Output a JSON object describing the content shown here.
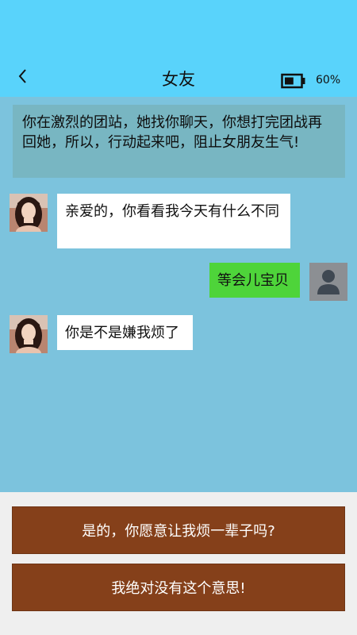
{
  "header": {
    "title": "女友",
    "battery_text": "60%",
    "battery_level": 0.6
  },
  "prompt": "你在激烈的团站，她找你聊天，你想打完团战再回她，所以，行动起来吧，阻止女朋友生气!",
  "messages": [
    {
      "from": "girlfriend",
      "text": "亲爱的，你看看我今天有什么不同"
    },
    {
      "from": "me",
      "text": "等会儿宝贝"
    },
    {
      "from": "girlfriend",
      "text": "你是不是嫌我烦了"
    }
  ],
  "choices": [
    {
      "label": "是的，你愿意让我烦一辈子吗?"
    },
    {
      "label": "我绝对没有这个意思!"
    }
  ],
  "colors": {
    "header_bg": "#59d3fb",
    "chat_bg": "#7cc3dd",
    "prompt_bg": "#78b6c2",
    "my_bubble": "#4ed43a",
    "their_bubble": "#ffffff",
    "choice_bg": "#85401a",
    "bottom_bg": "#efefef"
  },
  "icons": {
    "back": "chevron-left-icon",
    "battery": "battery-icon",
    "my_avatar": "user-silhouette-icon"
  }
}
